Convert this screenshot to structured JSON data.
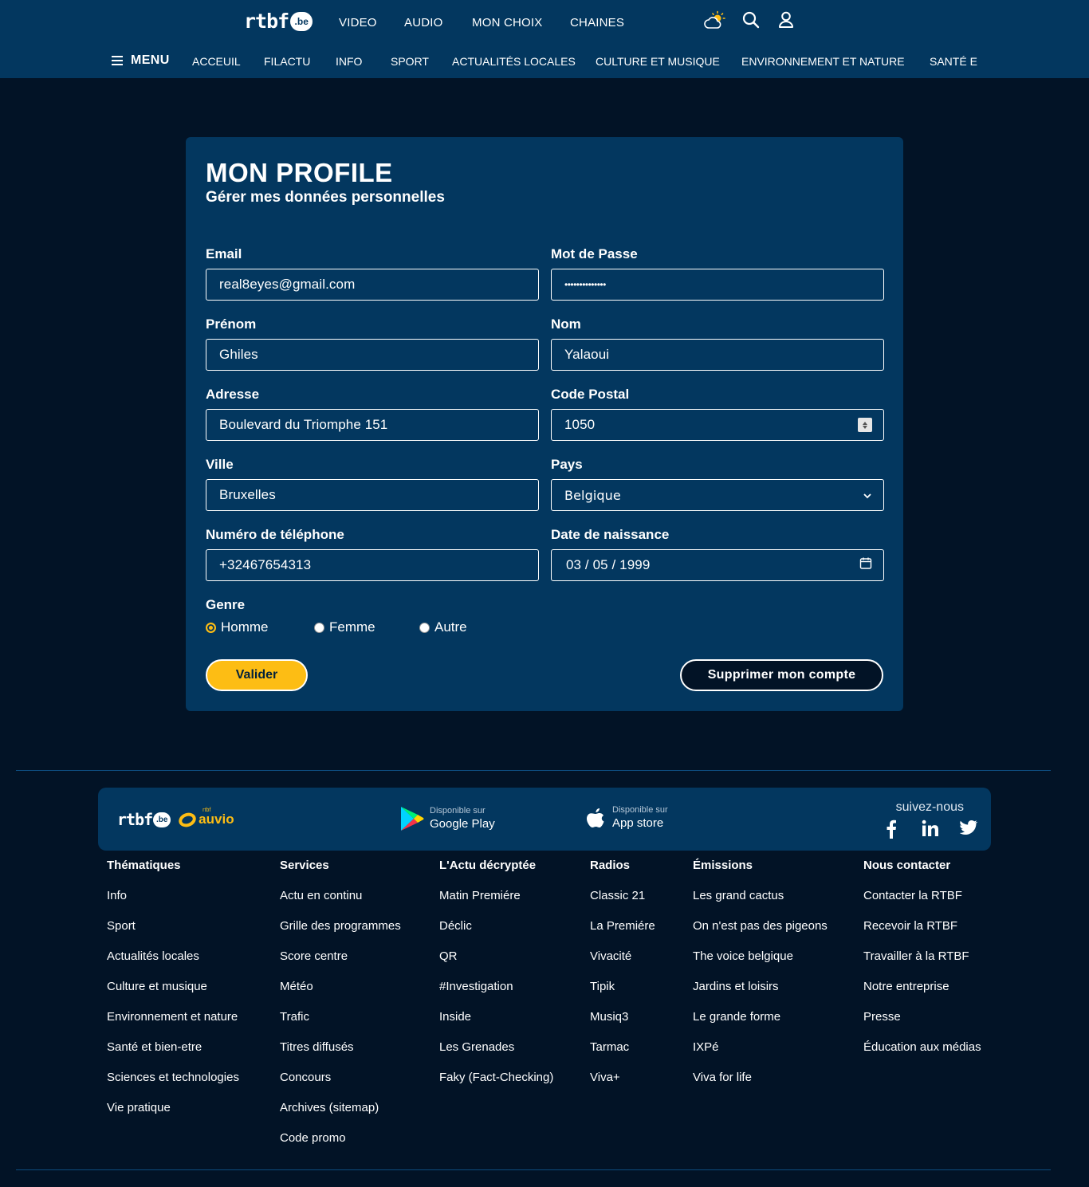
{
  "header": {
    "logo_text": "rtbf",
    "logo_badge": ".be",
    "top_nav": [
      "VIDEO",
      "AUDIO",
      "MON CHOIX",
      "CHAINES"
    ],
    "icons": [
      "weather-icon",
      "search-icon",
      "user-icon"
    ],
    "menu_label": "MENU",
    "menu_items": [
      "ACCEUIL",
      "FILACTU",
      "INFO",
      "SPORT",
      "ACTUALITÉS LOCALES",
      "CULTURE ET MUSIQUE",
      "ENVIRONNEMENT ET NATURE",
      "SANTÉ E"
    ]
  },
  "profile": {
    "title": "MON PROFILE",
    "subtitle": "Gérer mes données personnelles",
    "email": {
      "label": "Email",
      "value": "real8eyes@gmail.com"
    },
    "password": {
      "label": "Mot de Passe",
      "value": "••••••••••••••"
    },
    "first_name": {
      "label": "Prénom",
      "value": "Ghiles"
    },
    "last_name": {
      "label": "Nom",
      "value": "Yalaoui"
    },
    "address": {
      "label": "Adresse",
      "value": "Boulevard du Triomphe 151"
    },
    "postal_code": {
      "label": "Code Postal",
      "value": "1050"
    },
    "city": {
      "label": "Ville",
      "value": "Bruxelles"
    },
    "country": {
      "label": "Pays",
      "value": "Belgique"
    },
    "phone": {
      "label": "Numéro de téléphone",
      "value": "+32467654313"
    },
    "birthdate": {
      "label": "Date de naissance",
      "value": "03 / 05 / 1999"
    },
    "gender": {
      "label": "Genre",
      "options": [
        "Homme",
        "Femme",
        "Autre"
      ],
      "selected": "Homme"
    },
    "submit_label": "Valider",
    "delete_label": "Supprimer mon compte",
    "accent_color": "#fdbd14"
  },
  "footer": {
    "logo_text": "rtbf",
    "logo_badge": ".be",
    "auvio_brand": "rtbf",
    "auvio_text": "auvio",
    "google": {
      "small": "Disponible sur",
      "big": "Google Play"
    },
    "apple": {
      "small": "Disponible sur",
      "big": "App store"
    },
    "follow_label": "suivez-nous",
    "social_icons": [
      "facebook-icon",
      "linkedin-icon",
      "twitter-icon"
    ],
    "columns": [
      {
        "head": "Thématiques",
        "links": [
          "Info",
          "Sport",
          "Actualités locales",
          "Culture et musique",
          "Environnement et nature",
          "Santé et bien-etre",
          "Sciences et technologies",
          "Vie pratique"
        ]
      },
      {
        "head": "Services",
        "links": [
          "Actu en continu",
          "Grille des programmes",
          "Score centre",
          "Météo",
          "Trafic",
          "Titres diffusés",
          "Concours",
          "Archives (sitemap)",
          "Code promo"
        ]
      },
      {
        "head": "L'Actu décryptée",
        "links": [
          "Matin Premiére",
          "Déclic",
          "QR",
          "#Investigation",
          "Inside",
          "Les Grenades",
          "Faky (Fact-Checking)"
        ]
      },
      {
        "head": "Radios",
        "links": [
          "Classic 21",
          "La Premiére",
          "Vivacité",
          "Tipik",
          "Musiq3",
          "Tarmac",
          "Viva+"
        ]
      },
      {
        "head": "Émissions",
        "links": [
          "Les grand cactus",
          "On n'est pas des pigeons",
          "The voice belgique",
          "Jardins et loisirs",
          "Le grande forme",
          "IXPé",
          "Viva for life"
        ]
      },
      {
        "head": "Nous contacter",
        "links": [
          "Contacter la RTBF",
          "Recevoir la RTBF",
          "Travailler à la RTBF",
          "Notre entreprise",
          "Presse",
          "Éducation aux médias"
        ]
      }
    ]
  }
}
